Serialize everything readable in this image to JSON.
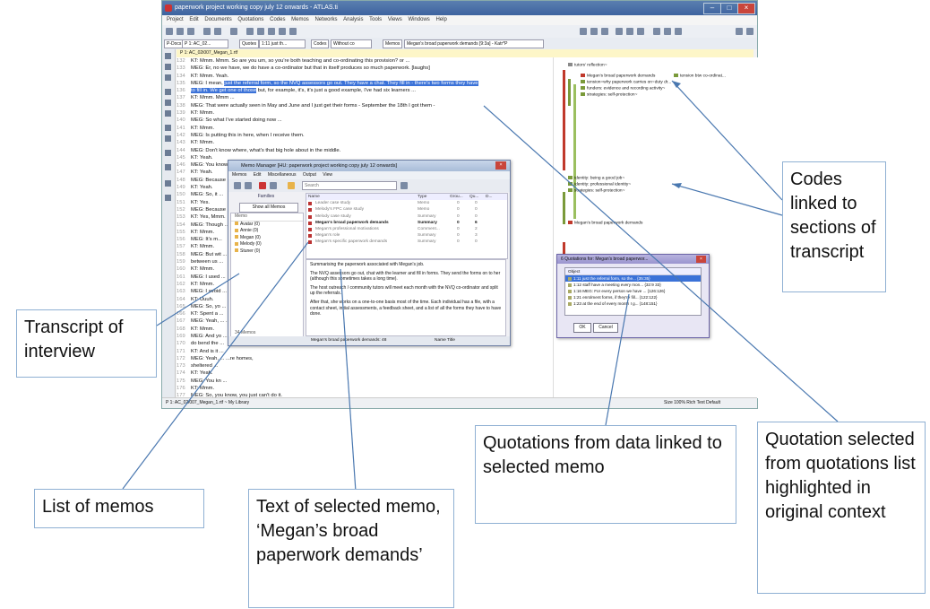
{
  "window": {
    "title": "paperwork project working copy july 12 onwards - ATLAS.ti",
    "menu": [
      "Project",
      "Edit",
      "Documents",
      "Quotations",
      "Codes",
      "Memos",
      "Networks",
      "Analysis",
      "Tools",
      "Views",
      "Windows",
      "Help"
    ],
    "nav": {
      "pdocs_label": "P-Docs",
      "pdoc_value": "P 1: AC_02...",
      "quotes_label": "Quotes",
      "quote_value": "1:11 just th...",
      "codes_label": "Codes",
      "code_value": "Without co",
      "memos_label": "Memos",
      "memo_value": "Megan's broad paperwork demands [9:3a] - Katr*P"
    },
    "doc_tab": "P 1: AC_02i007_Megan_1.rtf",
    "status_left": "P 1: AC_02i007_Megan_1.rtf ~ My Library",
    "status_right": "Size 100%   Rich Text   Default"
  },
  "transcript": [
    {
      "n": "132",
      "t": "KT: Mmm. Mmm. So are you um, so you're both teaching and co-ordinating this provision? or ..."
    },
    {
      "n": "133",
      "t": "MEG: Er, no we have, we do have a co-ordinator but that in itself produces so much paperwork. [laughs]"
    },
    {
      "n": "134",
      "t": "KT: Mmm. Yeah."
    },
    {
      "n": "135",
      "t": "MEG: I mean, ",
      "h": "just the referral form, so the NVQ assessors go out. They have a chat. They fill in - there's two forms they have",
      "a": ""
    },
    {
      "n": "136",
      "t": "",
      "h": "to fill in. We get one of those",
      "a": " but, for example, it's, it's just a good example, I've had six learners ..."
    },
    {
      "n": "137",
      "t": "KT: Mmm. Mmm ..."
    },
    {
      "n": "138",
      "t": "MEG: That were actually seen in May and June and I just get their forms - September the 18th I got them -"
    },
    {
      "n": "139",
      "t": "KT: Mmm."
    },
    {
      "n": "140",
      "t": "MEG: So what I've started doing now ..."
    },
    {
      "n": "141",
      "t": "KT: Mmm."
    },
    {
      "n": "142",
      "t": "MEG: Is putting this in here, when I receive them."
    },
    {
      "n": "143",
      "t": "KT: Mmm."
    },
    {
      "n": "144",
      "t": "MEG: Don't know where, what's that big hole about in the middle."
    },
    {
      "n": "145",
      "t": "KT: Yeah."
    },
    {
      "n": "146",
      "t": "MEG: You know ..."
    },
    {
      "n": "147",
      "t": "KT: Yeah."
    },
    {
      "n": "148",
      "t": "MEG: Because ..."
    },
    {
      "n": "149",
      "t": "KT: Yeah."
    },
    {
      "n": "150",
      "t": "MEG: So, it ..."
    },
    {
      "n": "151",
      "t": "KT: Yes."
    },
    {
      "n": "152",
      "t": "MEG: Because ..."
    },
    {
      "n": "153",
      "t": "KT: Yes, Mmm."
    },
    {
      "n": "154",
      "t": "MEG: Though ..."
    },
    {
      "n": "155",
      "t": "KT: Mmm."
    },
    {
      "n": "156",
      "t": "MEG: It's m..."
    },
    {
      "n": "157",
      "t": "KT: Mmm."
    },
    {
      "n": "158",
      "t": "MEG: But wit ...                                                                                       ...ve split them"
    },
    {
      "n": "159",
      "t": "between us ..."
    },
    {
      "n": "160",
      "t": "KT: Mmm."
    },
    {
      "n": "161",
      "t": "MEG: I used ..."
    },
    {
      "n": "162",
      "t": "KT: Mmm."
    },
    {
      "n": "163",
      "t": "MEG: I avoid ..."
    },
    {
      "n": "164",
      "t": "KT: Uuuh."
    },
    {
      "n": "165",
      "t": "MEG: So, yo ..."
    },
    {
      "n": "166",
      "t": "KT: Spent a ..."
    },
    {
      "n": "167",
      "t": "MEG: Yeah, ...                                                                                              ...ge ..."
    },
    {
      "n": "168",
      "t": "KT: Mmm."
    },
    {
      "n": "169",
      "t": "MEG: And yo ...                                                                                          ...ed to really but I"
    },
    {
      "n": "170",
      "t": "do bend the ..."
    },
    {
      "n": "171",
      "t": "KT: And is it ..."
    },
    {
      "n": "172",
      "t": "MEG: Yeah, ...                                                                                               ...re homes,"
    },
    {
      "n": "173",
      "t": "sheltered ..."
    },
    {
      "n": "174",
      "t": "KT: Yeah."
    },
    {
      "n": "175",
      "t": "MEG: You kn ..."
    },
    {
      "n": "176",
      "t": "KT: Mmm."
    },
    {
      "n": "177",
      "t": "MEG: So, you know, you just can't do it."
    },
    {
      "n": "178",
      "t": "KT: Yeah."
    }
  ],
  "margin_codes": [
    {
      "label": "tutors' reflection~",
      "color": "#8a8a8a"
    },
    {
      "label": "Megan's broad paperwork demands",
      "color": "#c0392b"
    },
    {
      "label": "tension btw co-ordinat...",
      "color": "#7a9a3a"
    },
    {
      "label": "tension=why paperwork carries on~duty dr...",
      "color": "#7a9a3a"
    },
    {
      "label": "funders: evidence and recording activity~",
      "color": "#7a9a3a"
    },
    {
      "label": "strategies: self-protection~",
      "color": "#7a9a3a"
    },
    {
      "label": "identity: being a good job~",
      "color": "#7a9a3a"
    },
    {
      "label": "identity: professional identity~",
      "color": "#7a9a3a"
    },
    {
      "label": "strategies: self-protection~",
      "color": "#7a9a3a"
    },
    {
      "label": "Megan's broad paperwork demands",
      "color": "#c0392b"
    }
  ],
  "memo_manager": {
    "title": "Memo Manager [HU: paperwork project working copy july 12 onwards]",
    "menu": [
      "Memos",
      "Edit",
      "Miscellaneous",
      "Output",
      "View"
    ],
    "search_placeholder": "Search",
    "families_heading": "Families",
    "show_all": "Show all Memos",
    "families_list_head": "Memo",
    "families": [
      "Avatar (0)",
      "Annie (0)",
      "Megan (0)",
      "Melody (0)",
      "Stuner (0)"
    ],
    "families_footer": "34 Memos",
    "columns": [
      "Name",
      "Type",
      "Grou...",
      "Qu...",
      "D..."
    ],
    "rows": [
      {
        "name": "Leader case study",
        "type": "Memo",
        "g": "0",
        "q": "0",
        "sel": false
      },
      {
        "name": "Melody's FPC case study",
        "type": "Memo",
        "g": "0",
        "q": "0",
        "sel": false
      },
      {
        "name": "Melody case study",
        "type": "Summary",
        "g": "0",
        "q": "0",
        "sel": false
      },
      {
        "name": "Megan's broad paperwork demands",
        "type": "Summary",
        "g": "0",
        "q": "6",
        "sel": true
      },
      {
        "name": "Megan's professional motivations",
        "type": "Comment...",
        "g": "0",
        "q": "2",
        "sel": false
      },
      {
        "name": "Megan's role",
        "type": "Summary",
        "g": "0",
        "q": "3",
        "sel": false
      },
      {
        "name": "Megan's specific paperwork demands",
        "type": "Summary",
        "g": "0",
        "q": "0",
        "sel": false
      }
    ],
    "memo_text": [
      "Summarising the paperwork associated with Megan's job.",
      "The NVQ assessors go out, chat with the learner and fill in forms. They send the forms on to her (although this sometimes takes a long time).",
      "The host outreach / community tutors will meet each month with the NVQ co-ordinator and split up the referrals.",
      "After that, she works on a one-to-one basis most of the time. Each individual has a file, with a contact sheet, initial assessments, a feedback sheet, and a list of all the forms they have to have done."
    ],
    "status_left": "Megan's broad paperwork demands: 48",
    "status_right": "Name   Title"
  },
  "quotations": {
    "title": "6 Quotations for: Megan's broad paperwor...",
    "column": "Object",
    "rows": [
      "1:11 just the referral form, so the... {35:35}",
      "1:12 staff have a meeting every mon... {32:9 33}",
      "1:16 MEG: For every person we have ... {126:126}",
      "1:21 enrolment forms, if they're fill... {122:122}",
      "1:23 at the end of every month I g... {148:151}"
    ],
    "ok": "OK",
    "cancel": "Cancel"
  },
  "annotations": {
    "codes": "Codes linked to sections of transcript",
    "transcript": "Transcript of interview",
    "memos": "List of memos",
    "memo_text": "Text of selected memo, ‘Megan’s broad paperwork demands’",
    "quotations": "Quotations from data linked to selected memo",
    "quotation_selected": "Quotation selected from quotations list highlighted in original context"
  }
}
